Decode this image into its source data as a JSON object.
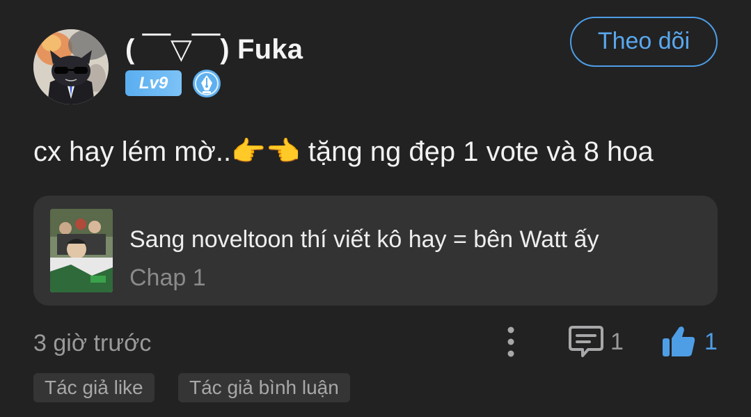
{
  "user": {
    "display_name": "( ￣▽￣) Fuka",
    "level": "Lv9",
    "follow_label": "Theo dõi"
  },
  "comment": {
    "text": "cx hay lém mờ..👉👈 tặng ng đẹp 1 vote và 8 hoa"
  },
  "story": {
    "title": "Sang noveltoon thí viết kô hay = bên Watt ấy",
    "chapter": "Chap 1"
  },
  "footer": {
    "timestamp": "3 giờ trước",
    "comment_count": "1",
    "like_count": "1"
  },
  "tags": {
    "author_like": "Tác giả like",
    "author_comment": "Tác giả bình luận"
  },
  "icons": {
    "writer": "fountain-pen-icon",
    "more": "vertical-dots-icon",
    "comment": "comment-bubble-icon",
    "like": "thumbs-up-icon"
  },
  "colors": {
    "background": "#222223",
    "card": "#333334",
    "accent": "#4e9ee6",
    "level_badge": "#6ab8f3",
    "muted_text": "#9a9a9c"
  }
}
